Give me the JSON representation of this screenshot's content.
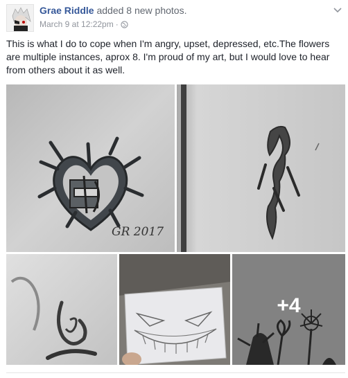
{
  "post": {
    "author": "Grae Riddle",
    "action": "added 8 new photos.",
    "date": "March 9 at 12:22pm",
    "separator": "·",
    "privacy_icon": "globe-icon",
    "menu_icon": "chevron-down-icon",
    "text": "This is what I do to cope when I'm angry, upset, depressed, etc.The flowers are multiple instances, aprox 8. I'm proud of my art, but I would love to hear from others about it as well."
  },
  "photos": {
    "items": [
      {
        "id": "photo-heart-drawing",
        "signature": "GR 2017"
      },
      {
        "id": "photo-tribal-drawing"
      },
      {
        "id": "photo-ribbon-drawing"
      },
      {
        "id": "photo-grin-drawing"
      },
      {
        "id": "photo-flowers-drawing"
      }
    ],
    "more_count": "+4"
  },
  "colors": {
    "author": "#365899",
    "meta": "#90949c",
    "text": "#1d2129"
  }
}
